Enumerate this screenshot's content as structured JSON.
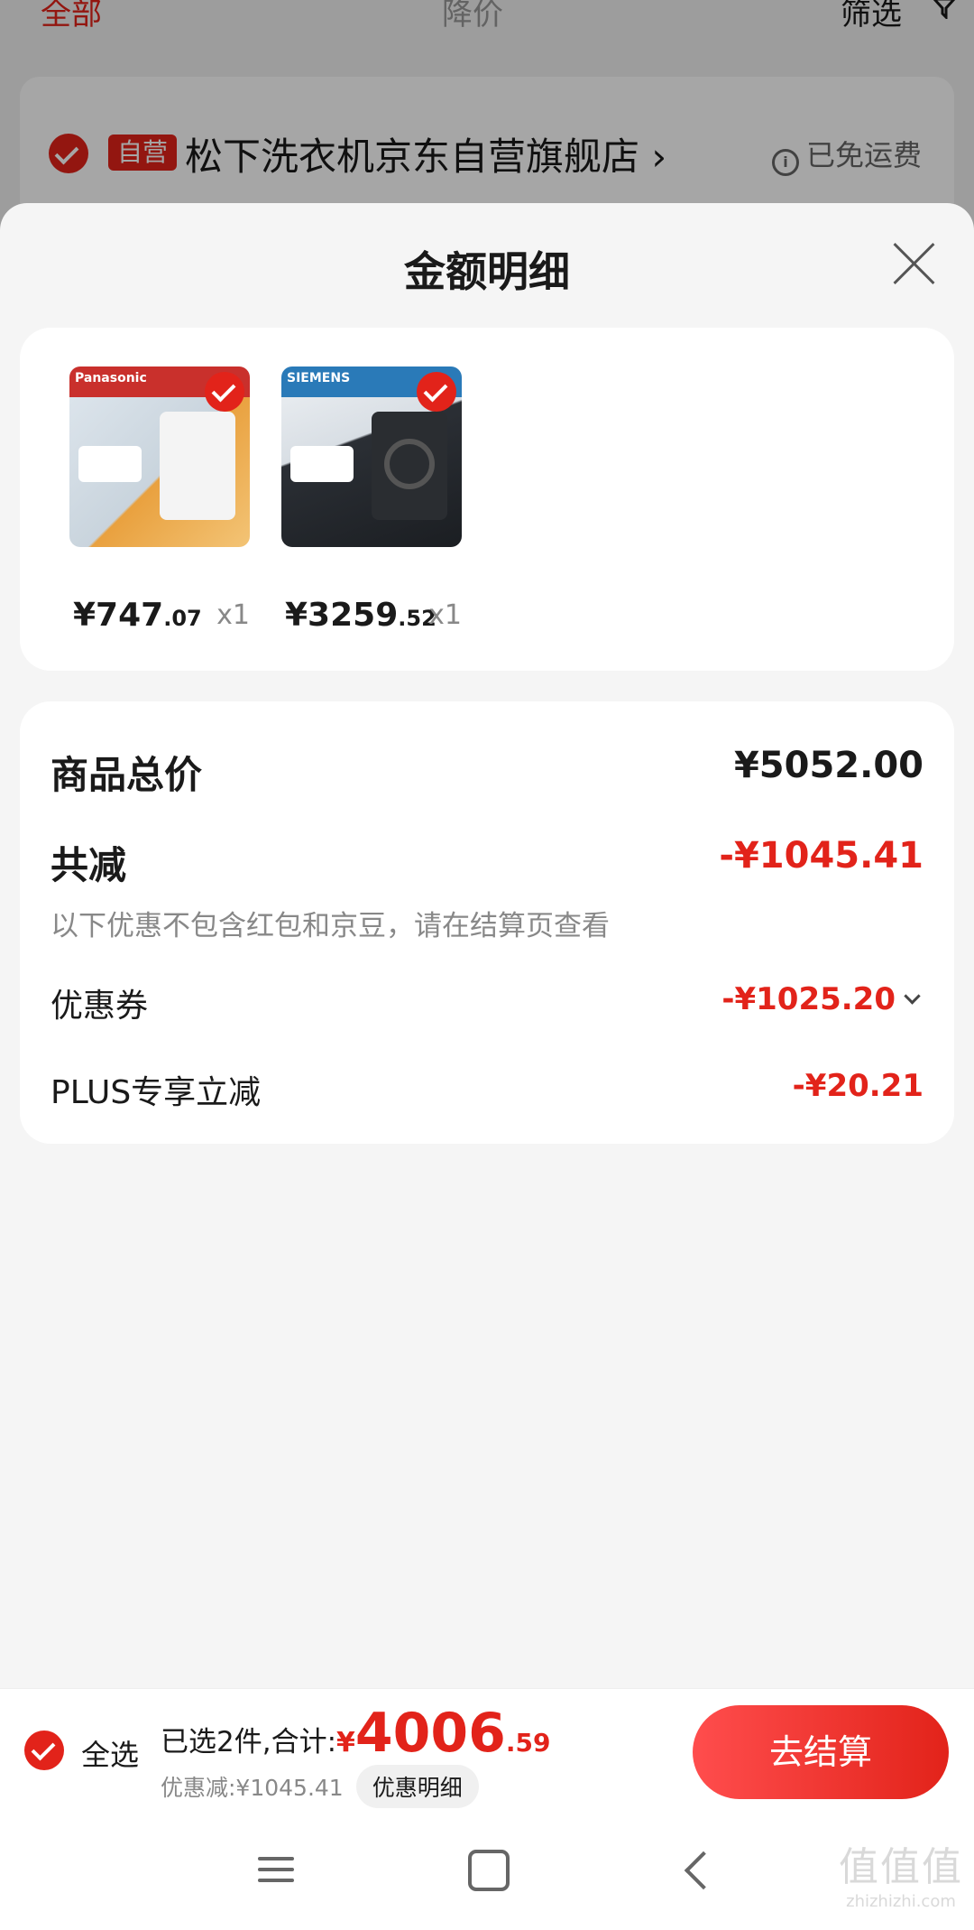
{
  "background": {
    "tabs": [
      "全部",
      "降价",
      "筛选"
    ],
    "self_operated": "自营",
    "store_name": "松下洗衣机京东自营旗舰店 ›",
    "free_shipping": "已免运费"
  },
  "sheet": {
    "title": "金额明细"
  },
  "products": [
    {
      "brand": "Panasonic",
      "price_int": "¥747",
      "price_dec": ".07",
      "qty": "x1"
    },
    {
      "brand": "SIEMENS",
      "price_int": "¥3259",
      "price_dec": ".52",
      "qty": "x1"
    }
  ],
  "summary": {
    "total_label": "商品总价",
    "total_value": "¥5052.00",
    "reduce_label": "共减",
    "reduce_value": "-¥1045.41",
    "reduce_hint": "以下优惠不包含红包和京豆，请在结算页查看",
    "coupon_label": "优惠券",
    "coupon_value": "-¥1025.20",
    "plus_label": "PLUS专享立减",
    "plus_value": "-¥20.21"
  },
  "bottom": {
    "select_all": "全选",
    "selected_text": "已选2件,合计:",
    "currency": "¥",
    "total_int": "4006",
    "total_dec": ".59",
    "discount_text": "优惠减:¥1045.41",
    "detail_label": "优惠明细",
    "checkout_label": "去结算"
  },
  "watermark": {
    "big": "值值值",
    "small": "zhizhizhi.com"
  },
  "colors": {
    "accent": "#e2231a",
    "text": "#1a1a1a",
    "muted": "#888888"
  }
}
